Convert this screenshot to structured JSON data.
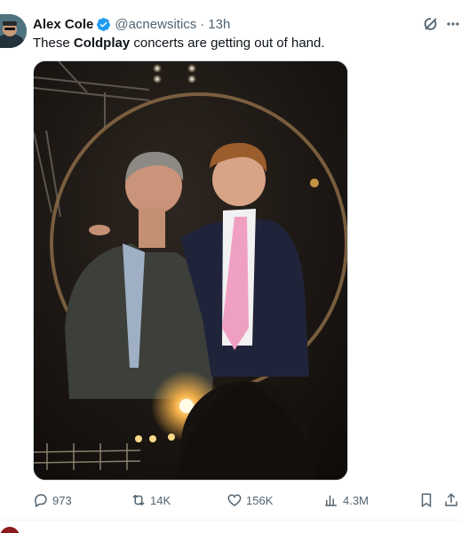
{
  "tweet": {
    "author_name": "Alex Cole",
    "handle": "@acnewsitics",
    "separator": "·",
    "time": "13h",
    "text_before": "These ",
    "text_bold": "Coldplay",
    "text_after": " concerts are getting out of hand.",
    "verified_color": "#1d9bf0"
  },
  "actions": {
    "replies": "973",
    "reposts": "14K",
    "likes": "156K",
    "views": "4.3M"
  },
  "icons": {
    "reply": "reply-icon",
    "repost": "repost-icon",
    "like": "heart-icon",
    "views": "views-chart-icon",
    "bookmark": "bookmark-icon",
    "share": "share-icon",
    "grok": "grok-icon",
    "more": "more-dots-icon"
  },
  "colors": {
    "secondary_text": "#536471",
    "divider": "#eff3f4"
  }
}
